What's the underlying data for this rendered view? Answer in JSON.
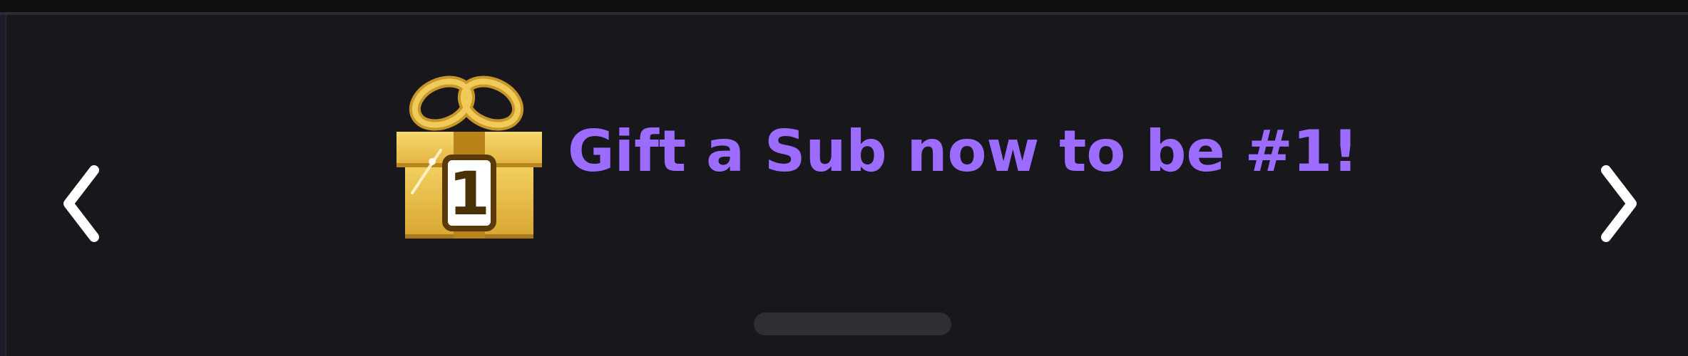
{
  "promo": {
    "text": "Gift a Sub now to be #1!",
    "badge_number": "1",
    "text_color": "#9b6cff"
  },
  "icons": {
    "gift": "gift-box-rank-1-icon",
    "previous": "chevron-left-icon",
    "next": "chevron-right-icon"
  },
  "colors": {
    "background": "#18171b",
    "gift_gold": "#e7b73c",
    "arrow": "#ffffff",
    "pager": "#2f2e35"
  }
}
